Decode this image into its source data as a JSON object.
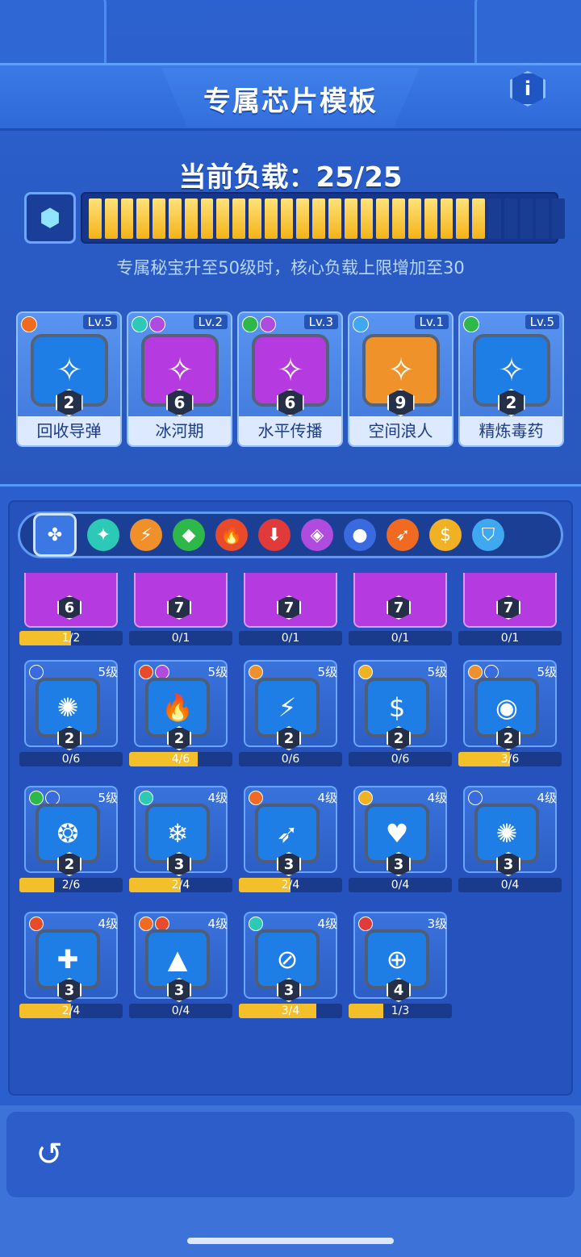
{
  "header": {
    "title": "专属芯片模板",
    "info_label": "i"
  },
  "load": {
    "title": "当前负载：25/25",
    "current": 25,
    "max": 25,
    "note": "专属秘宝升至50级时，核心负载上限增加至30"
  },
  "equipped": [
    {
      "name": "回收导弹",
      "level": "Lv.5",
      "count": "2",
      "color": "blue",
      "icon": "missile-icon",
      "tags": [
        "#f06a22"
      ]
    },
    {
      "name": "冰河期",
      "level": "Lv.2",
      "count": "6",
      "color": "purple",
      "icon": "snowflake-icon",
      "tags": [
        "#2bc9b6",
        "#b04be0"
      ]
    },
    {
      "name": "水平传播",
      "level": "Lv.3",
      "count": "6",
      "color": "purple",
      "icon": "wave-icon",
      "tags": [
        "#2fb84a",
        "#b04be0"
      ]
    },
    {
      "name": "空间浪人",
      "level": "Lv.1",
      "count": "9",
      "color": "orange",
      "icon": "star-icon",
      "tags": [
        "#3fa8f0"
      ]
    },
    {
      "name": "精炼毒药",
      "level": "Lv.5",
      "count": "2",
      "color": "blue",
      "icon": "poison-icon",
      "tags": [
        "#2fb84a"
      ]
    }
  ],
  "filters": [
    {
      "name": "all",
      "glyph": "✤",
      "color": "#3b78e4"
    },
    {
      "name": "ice",
      "glyph": "✦",
      "color": "#2bc9b6"
    },
    {
      "name": "electric",
      "glyph": "⚡",
      "color": "#f0902a"
    },
    {
      "name": "poison",
      "glyph": "◆",
      "color": "#2fb84a"
    },
    {
      "name": "fire",
      "glyph": "🔥",
      "color": "#e84a2a"
    },
    {
      "name": "physical",
      "glyph": "⬇",
      "color": "#e03a3a"
    },
    {
      "name": "energy",
      "glyph": "◈",
      "color": "#b04be0"
    },
    {
      "name": "bomb",
      "glyph": "●",
      "color": "#3a6ae0"
    },
    {
      "name": "missile",
      "glyph": "➶",
      "color": "#f06a22"
    },
    {
      "name": "money",
      "glyph": "$",
      "color": "#f0b224"
    },
    {
      "name": "shield",
      "glyph": "⛉",
      "color": "#3fa8f0"
    }
  ],
  "chips": [
    {
      "row": 0,
      "level": "",
      "count": "6",
      "progress": "1/2",
      "fill": 0.5,
      "color": "purple",
      "glyph": "⚙",
      "tags": []
    },
    {
      "row": 0,
      "level": "",
      "count": "7",
      "progress": "0/1",
      "fill": 0,
      "color": "purple",
      "glyph": "◈",
      "tags": []
    },
    {
      "row": 0,
      "level": "",
      "count": "7",
      "progress": "0/1",
      "fill": 0,
      "color": "purple",
      "glyph": "✺",
      "tags": []
    },
    {
      "row": 0,
      "level": "",
      "count": "7",
      "progress": "0/1",
      "fill": 0,
      "color": "purple",
      "glyph": "❂",
      "tags": []
    },
    {
      "row": 0,
      "level": "",
      "count": "7",
      "progress": "0/1",
      "fill": 0,
      "color": "purple",
      "glyph": "❂",
      "tags": []
    },
    {
      "row": 1,
      "level": "5级",
      "count": "2",
      "progress": "0/6",
      "fill": 0,
      "color": "blue",
      "glyph": "✺",
      "tags": [
        "#3a6ae0"
      ]
    },
    {
      "row": 1,
      "level": "5级",
      "count": "2",
      "progress": "4/6",
      "fill": 0.667,
      "color": "blue",
      "glyph": "🔥",
      "tags": [
        "#e84a2a",
        "#b04be0"
      ]
    },
    {
      "row": 1,
      "level": "5级",
      "count": "2",
      "progress": "0/6",
      "fill": 0,
      "color": "blue",
      "glyph": "⚡",
      "tags": [
        "#f0902a"
      ]
    },
    {
      "row": 1,
      "level": "5级",
      "count": "2",
      "progress": "0/6",
      "fill": 0,
      "color": "blue",
      "glyph": "$",
      "tags": [
        "#f0b224"
      ]
    },
    {
      "row": 1,
      "level": "5级",
      "count": "2",
      "progress": "3/6",
      "fill": 0.5,
      "color": "blue",
      "glyph": "◉",
      "tags": [
        "#f0902a",
        "#3a6ae0"
      ]
    },
    {
      "row": 2,
      "level": "5级",
      "count": "2",
      "progress": "2/6",
      "fill": 0.333,
      "color": "blue",
      "glyph": "❂",
      "tags": [
        "#2fb84a",
        "#3a6ae0"
      ]
    },
    {
      "row": 2,
      "level": "4级",
      "count": "3",
      "progress": "2/4",
      "fill": 0.5,
      "color": "blue",
      "glyph": "❄",
      "tags": [
        "#2bc9b6"
      ]
    },
    {
      "row": 2,
      "level": "4级",
      "count": "3",
      "progress": "2/4",
      "fill": 0.5,
      "color": "blue",
      "glyph": "➶",
      "tags": [
        "#f06a22"
      ]
    },
    {
      "row": 2,
      "level": "4级",
      "count": "3",
      "progress": "0/4",
      "fill": 0,
      "color": "blue",
      "glyph": "♥",
      "tags": [
        "#f0b224"
      ]
    },
    {
      "row": 2,
      "level": "4级",
      "count": "3",
      "progress": "0/4",
      "fill": 0,
      "color": "blue",
      "glyph": "✺",
      "tags": [
        "#3a6ae0"
      ]
    },
    {
      "row": 3,
      "level": "4级",
      "count": "3",
      "progress": "2/4",
      "fill": 0.5,
      "color": "blue",
      "glyph": "✚",
      "tags": [
        "#e84a2a"
      ]
    },
    {
      "row": 3,
      "level": "4级",
      "count": "3",
      "progress": "0/4",
      "fill": 0,
      "color": "blue",
      "glyph": "▲",
      "tags": [
        "#f06a22",
        "#e84a2a"
      ]
    },
    {
      "row": 3,
      "level": "4级",
      "count": "3",
      "progress": "3/4",
      "fill": 0.75,
      "color": "blue",
      "glyph": "⊘",
      "tags": [
        "#2bc9b6"
      ]
    },
    {
      "row": 3,
      "level": "3级",
      "count": "4",
      "progress": "1/3",
      "fill": 0.333,
      "color": "blue",
      "glyph": "⊕",
      "tags": [
        "#e03a3a"
      ]
    }
  ],
  "footer": {
    "back_glyph": "↺"
  }
}
